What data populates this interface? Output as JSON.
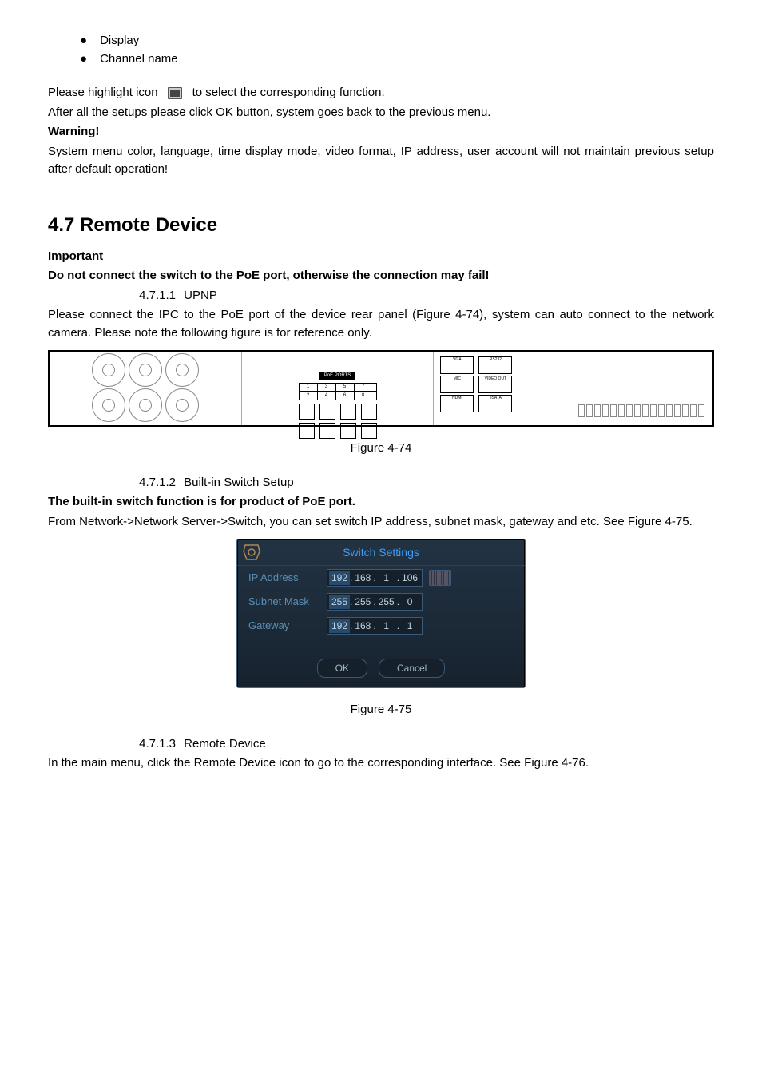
{
  "bullets": [
    "Display",
    "Channel name"
  ],
  "p1": "Please highlight icon",
  "p1b": "to select the corresponding function.",
  "p2": "After all the setups please click OK button, system goes back to the previous menu.",
  "warning": "Warning!",
  "p3": "System menu color, language, time display mode, video format, IP address, user account will not maintain previous setup after default operation!",
  "h2": "4.7  Remote Device",
  "important": "Important",
  "important2": "Do not connect the switch to the PoE port, otherwise the connection may fail!",
  "sec411_num": "4.7.1.1",
  "sec411": "UPNP",
  "p4": "Please connect the IPC to the PoE port of the device rear panel (Figure 4-74), system can auto connect to the network camera. Please note the following figure is for reference only.",
  "poe_label": "PoE PORTS",
  "poe_nums_top": [
    "1",
    "3",
    "5",
    "7"
  ],
  "poe_nums_bottom": [
    "2",
    "4",
    "6",
    "8"
  ],
  "right_labels": [
    "VGA",
    "RS232",
    "MIC",
    "VIDEO OUT",
    "eSATA",
    "HDMI"
  ],
  "fig474": "Figure 4-74",
  "sec412_num": "4.7.1.2",
  "sec412": "Built-in Switch Setup",
  "p5": "The built-in switch function is for product of PoE port.",
  "p6": "From Network->Network Server->Switch, you can set switch IP address, subnet mask, gateway and etc. See Figure 4-75.",
  "dialog": {
    "title": "Switch Settings",
    "rows": [
      {
        "label": "IP Address",
        "oct": [
          "192",
          "168",
          "1",
          "106"
        ],
        "kbd": true
      },
      {
        "label": "Subnet Mask",
        "oct": [
          "255",
          "255",
          "255",
          "0"
        ],
        "kbd": false
      },
      {
        "label": "Gateway",
        "oct": [
          "192",
          "168",
          "1",
          "1"
        ],
        "kbd": false
      }
    ],
    "ok": "OK",
    "cancel": "Cancel"
  },
  "fig475": "Figure 4-75",
  "sec413_num": "4.7.1.3",
  "sec413": "Remote Device",
  "p7": "In the main menu, click the Remote Device icon to go to the corresponding interface. See Figure 4-76."
}
